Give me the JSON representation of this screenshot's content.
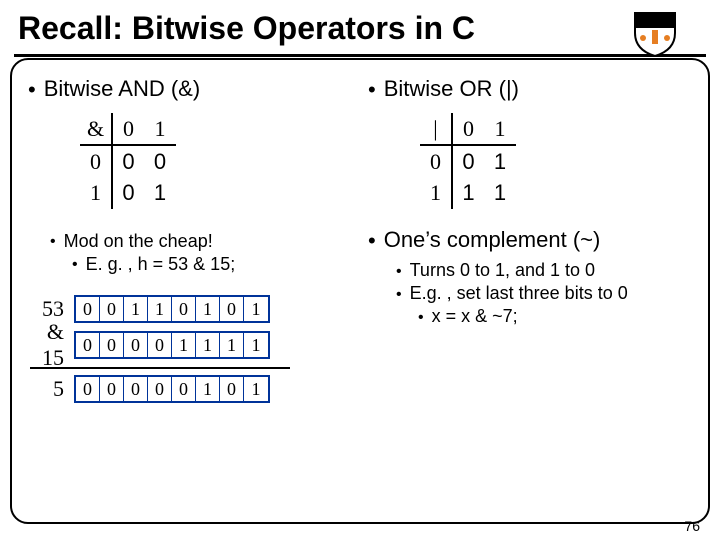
{
  "title": "Recall: Bitwise Operators in C",
  "left": {
    "heading": "Bitwise AND (&)",
    "op": "&",
    "t": {
      "c0": "0",
      "c1": "1",
      "r0": "0",
      "r1": "1",
      "v00": "0",
      "v01": "0",
      "v10": "0",
      "v11": "1"
    },
    "mod1": "Mod on the cheap!",
    "mod2": "E. g. , h = 53 & 15;",
    "ex": {
      "lbl53": "53",
      "b53": [
        "0",
        "0",
        "1",
        "1",
        "0",
        "1",
        "0",
        "1"
      ],
      "lbl15": "& 15",
      "b15": [
        "0",
        "0",
        "0",
        "0",
        "1",
        "1",
        "1",
        "1"
      ],
      "lbl5": "5",
      "b5": [
        "0",
        "0",
        "0",
        "0",
        "0",
        "1",
        "0",
        "1"
      ]
    }
  },
  "right": {
    "heading": "Bitwise OR (|)",
    "op": "|",
    "t": {
      "c0": "0",
      "c1": "1",
      "r0": "0",
      "r1": "1",
      "v00": "0",
      "v01": "1",
      "v10": "1",
      "v11": "1"
    },
    "comp_title": "One’s complement (~)",
    "comp1": "Turns 0 to 1, and 1 to 0",
    "comp2": "E.g. , set last three bits to 0",
    "comp3": "x = x & ~7;"
  },
  "pagenum": "76",
  "chart_data": {
    "type": "table",
    "title": "Bitwise operator truth tables and example",
    "and_truth_table": {
      "inputs": [
        0,
        1
      ],
      "rows": [
        [
          0,
          0
        ],
        [
          0,
          1
        ]
      ]
    },
    "or_truth_table": {
      "inputs": [
        0,
        1
      ],
      "rows": [
        [
          0,
          1
        ],
        [
          1,
          1
        ]
      ]
    },
    "example_and": {
      "operand_a": {
        "decimal": 53,
        "bits": [
          0,
          0,
          1,
          1,
          0,
          1,
          0,
          1
        ]
      },
      "operand_b": {
        "decimal": 15,
        "bits": [
          0,
          0,
          0,
          0,
          1,
          1,
          1,
          1
        ],
        "label": "& 15"
      },
      "result": {
        "decimal": 5,
        "bits": [
          0,
          0,
          0,
          0,
          0,
          1,
          0,
          1
        ]
      }
    }
  }
}
